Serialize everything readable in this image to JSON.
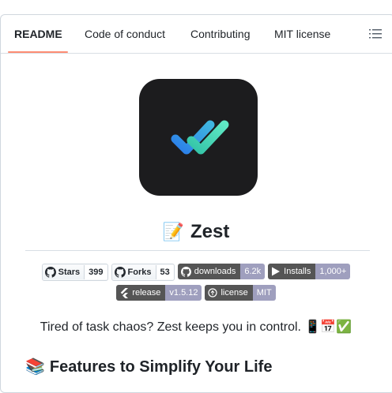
{
  "tabs": [
    {
      "label": "README",
      "active": true
    },
    {
      "label": "Code of conduct",
      "active": false
    },
    {
      "label": "Contributing",
      "active": false
    },
    {
      "label": "MIT license",
      "active": false
    }
  ],
  "readme": {
    "title_emoji": "📝",
    "title": "Zest",
    "tagline": "Tired of task chaos? Zest keeps you in control. 📱📅✅",
    "features_emoji": "📚",
    "features_heading": "Features to Simplify Your Life"
  },
  "badges": {
    "stars": {
      "label": "Stars",
      "count": "399"
    },
    "forks": {
      "label": "Forks",
      "count": "53"
    },
    "downloads": {
      "label": "downloads",
      "value": "6.2k",
      "color": "#9f9fbe"
    },
    "installs": {
      "label": "Installs",
      "value": "1,000+",
      "color": "#9f9fbe"
    },
    "release": {
      "label": "release",
      "value": "v1.5.12",
      "color": "#9f9fbe"
    },
    "license": {
      "label": "license",
      "value": "MIT",
      "color": "#9f9fbe"
    }
  },
  "colors": {
    "tab_underline": "#fd8c73",
    "logo_bg": "#1c1c1e",
    "check_gradient_start": "#2b7de9",
    "check_gradient_end": "#4fe3c1"
  },
  "icons": [
    "outline-list-icon",
    "github-icon",
    "play-store-icon",
    "flutter-icon",
    "law-icon",
    "double-check-icon"
  ]
}
